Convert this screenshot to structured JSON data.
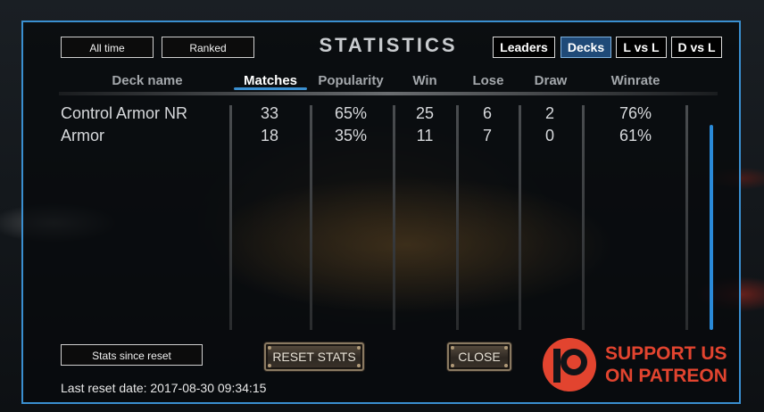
{
  "filters": {
    "time_label": "All time",
    "mode_label": "Ranked",
    "reset_label": "Stats since reset"
  },
  "title": "STATISTICS",
  "tabs": [
    {
      "label": "Leaders",
      "active": false
    },
    {
      "label": "Decks",
      "active": true
    },
    {
      "label": "L vs L",
      "active": false
    },
    {
      "label": "D vs L",
      "active": false
    }
  ],
  "table": {
    "columns": [
      "Deck name",
      "Matches",
      "Popularity",
      "Win",
      "Lose",
      "Draw",
      "Winrate"
    ],
    "sorted_column": "Matches",
    "rows": [
      [
        "Control Armor NR",
        "33",
        "65%",
        "25",
        "6",
        "2",
        "76%"
      ],
      [
        "Armor",
        "18",
        "35%",
        "11",
        "7",
        "0",
        "61%"
      ]
    ]
  },
  "actions": {
    "reset_label": "RESET STATS",
    "close_label": "CLOSE"
  },
  "patreon": {
    "line1": "SUPPORT US",
    "line2": "ON PATREON",
    "color": "#e2442f"
  },
  "footer": {
    "reset_date": "Last reset date: 2017-08-30 09:34:15"
  },
  "colors": {
    "accent": "#3a8fd0",
    "active_tab": "#1f4a78"
  }
}
